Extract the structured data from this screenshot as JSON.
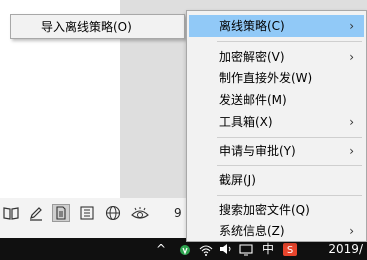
{
  "submenu": {
    "items": [
      {
        "label": "导入离线策略(O)"
      }
    ]
  },
  "context_menu": {
    "items": [
      {
        "label": "离线策略(C)",
        "has_submenu": true,
        "highlighted": true
      },
      {
        "label": "加密解密(V)",
        "has_submenu": true
      },
      {
        "label": "制作直接外发(W)",
        "has_submenu": false
      },
      {
        "label": "发送邮件(M)",
        "has_submenu": false
      },
      {
        "label": "工具箱(X)",
        "has_submenu": true
      },
      {
        "label": "申请与审批(Y)",
        "has_submenu": true
      },
      {
        "label": "截屏(J)",
        "has_submenu": false
      },
      {
        "label": "搜索加密文件(Q)",
        "has_submenu": false
      },
      {
        "label": "系统信息(Z)",
        "has_submenu": true
      }
    ],
    "arrow_glyph": "›"
  },
  "status_bar": {
    "icons": [
      "book-icon",
      "pen-icon",
      "page-icon",
      "list-icon",
      "globe-icon",
      "eye-icon"
    ],
    "active_icon": "page-icon",
    "zoom_partial": "9"
  },
  "taskbar": {
    "tray_chevron": "^",
    "ime_label": "中",
    "date_partial": "2019/"
  },
  "colors": {
    "highlight": "#91c9f7",
    "menu_bg": "#f2f2f2",
    "taskbar_bg": "#101010"
  }
}
